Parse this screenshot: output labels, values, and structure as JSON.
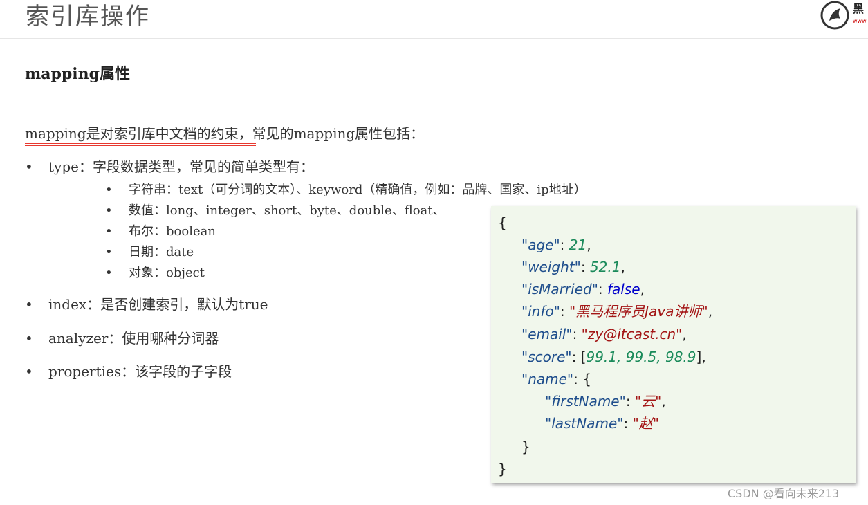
{
  "header": {
    "title": "索引库操作",
    "logo_text": "黑",
    "logo_sub": "www"
  },
  "section": {
    "title": "mapping属性"
  },
  "intro": {
    "text": "mapping是对索引库中文档的约束，常见的mapping属性包括："
  },
  "bullets": {
    "type": "type：字段数据类型，常见的简单类型有：",
    "type_sub": [
      "字符串：text（可分词的文本）、keyword（精确值，例如：品牌、国家、ip地址）",
      "数值：long、integer、short、byte、double、float、",
      "布尔：boolean",
      "日期：date",
      "对象：object"
    ],
    "index": "index：是否创建索引，默认为true",
    "analyzer": "analyzer：使用哪种分词器",
    "properties": "properties：该字段的子字段"
  },
  "bullet_glyph": "•",
  "code": {
    "open": "{",
    "age_key": "\"age\"",
    "age_val": "21",
    "weight_key": "\"weight\"",
    "weight_val": "52.1",
    "married_key": "\"isMarried\"",
    "married_val": "false",
    "info_key": "\"info\"",
    "info_val": "\"黑马程序员Java讲师\"",
    "email_key": "\"email\"",
    "email_val": "\"zy@itcast.cn\"",
    "score_key": "\"score\"",
    "score_vals": "99.1, 99.5, 98.9",
    "name_key": "\"name\"",
    "first_key": "\"firstName\"",
    "first_val": "\"云\"",
    "last_key": "\"lastName\"",
    "last_val": "\"赵\"",
    "inner_close": "}",
    "close": "}"
  },
  "watermark": "CSDN @看向未来213",
  "colors": {
    "underline": "#e8382f",
    "code_bg": "#f1f7ec",
    "key": "#1f4e8c",
    "number": "#1a8a5a",
    "boolean": "#0000cc",
    "string": "#a31515"
  }
}
